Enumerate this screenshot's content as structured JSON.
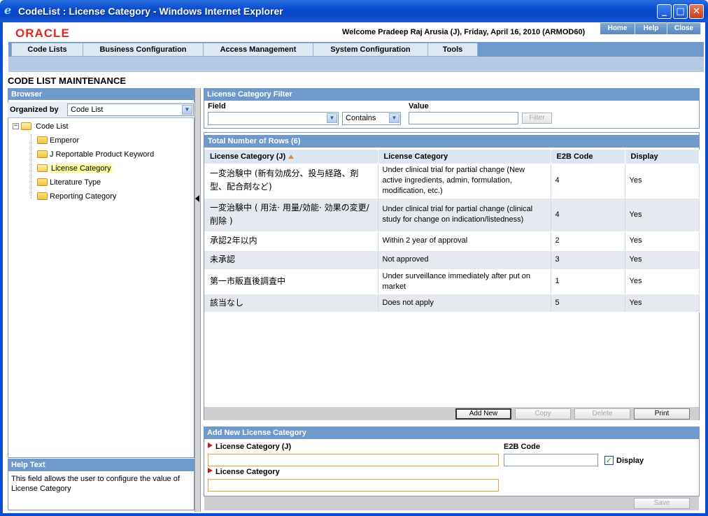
{
  "window": {
    "title": "CodeList : License Category - Windows Internet Explorer"
  },
  "header": {
    "logo": "ORACLE",
    "welcome": "Welcome Pradeep Raj Arusia (J), Friday, April 16, 2010 (ARMOD60)",
    "links": [
      "Home",
      "Help",
      "Close"
    ]
  },
  "nav": {
    "tabs": [
      "Code Lists",
      "Business Configuration",
      "Access Management",
      "System Configuration",
      "Tools"
    ]
  },
  "page": {
    "title": "CODE LIST MAINTENANCE"
  },
  "browser": {
    "heading": "Browser",
    "organized_by_label": "Organized by",
    "organized_by_value": "Code List",
    "root": "Code List",
    "items": [
      "Emperor",
      "J Reportable Product Keyword",
      "License Category",
      "Literature Type",
      "Reporting Category"
    ],
    "selected": "License Category"
  },
  "help": {
    "heading": "Help Text",
    "text": "This field allows the user to configure the value of License Category"
  },
  "filter": {
    "heading": "License Category Filter",
    "field_label": "Field",
    "field_value": "",
    "operator": "Contains",
    "value_label": "Value",
    "value": "",
    "button": "Filter"
  },
  "table": {
    "caption": "Total Number of Rows (6)",
    "columns": [
      "License Category (J)",
      "License Category",
      "E2B Code",
      "Display"
    ],
    "rows": [
      {
        "ja": "一変治験中 (新有効成分、投与経路、剤型、配合剤など)",
        "en": "Under clinical trial for partial change (New active ingredients, admin, formulation, modification, etc.)",
        "code": "4",
        "display": "Yes"
      },
      {
        "ja": "一変治験中 ( 用法· 用量/効能· 効果の変更/削除 )",
        "en": "Under clinical trial for partial change (clinical study for change on indication/listedness)",
        "code": "4",
        "display": "Yes"
      },
      {
        "ja": "承認2年以内",
        "en": "Within 2 year of approval",
        "code": "2",
        "display": "Yes"
      },
      {
        "ja": "未承認",
        "en": "Not approved",
        "code": "3",
        "display": "Yes"
      },
      {
        "ja": "第一市販直後調査中",
        "en": "Under surveillance immediately after put on market",
        "code": "1",
        "display": "Yes"
      },
      {
        "ja": "該当なし",
        "en": "Does not apply",
        "code": "5",
        "display": "Yes"
      }
    ],
    "buttons": [
      "Add New",
      "Copy",
      "Delete",
      "Print"
    ]
  },
  "add_new": {
    "heading": "Add New License Category",
    "lc_j_label": "License Category (J)",
    "lc_j_value": "",
    "e2b_label": "E2B Code",
    "e2b_value": "",
    "display_label": "Display",
    "display_checked": true,
    "lc_label": "License Category",
    "lc_value": "",
    "save": "Save"
  },
  "colors": {
    "accent": "#6e99ca",
    "oracle_red": "#e0281e",
    "title_bar": "#0a4ccf"
  }
}
